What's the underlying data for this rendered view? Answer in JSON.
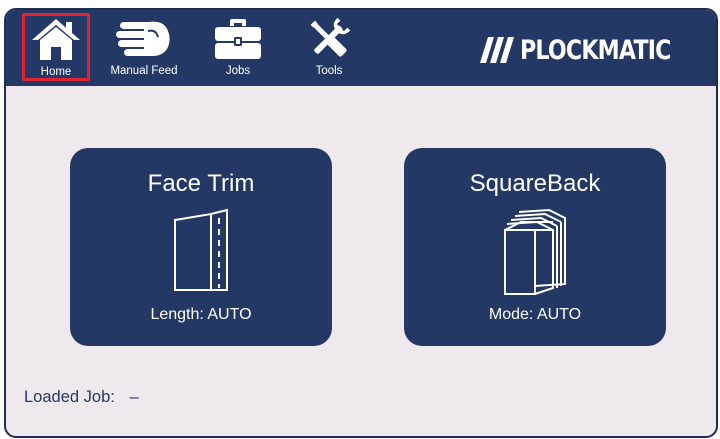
{
  "nav": {
    "home": {
      "label": "Home",
      "icon": "home-icon",
      "selected": true
    },
    "manual_feed": {
      "label": "Manual Feed",
      "icon": "hand-icon"
    },
    "jobs": {
      "label": "Jobs",
      "icon": "briefcase-icon"
    },
    "tools": {
      "label": "Tools",
      "icon": "tools-icon"
    }
  },
  "brand": {
    "name": "PLOCKMATIC"
  },
  "cards": {
    "face_trim": {
      "title": "Face Trim",
      "status": "Length: AUTO",
      "icon": "folded-sheet-icon"
    },
    "squareback": {
      "title": "SquareBack",
      "status": "Mode: AUTO",
      "icon": "book-stack-icon"
    }
  },
  "loaded_job": {
    "label": "Loaded Job:",
    "value": "–"
  },
  "colors": {
    "navy": "#233865",
    "background": "#efe9ed",
    "highlight": "#e0212f",
    "text_on_dark": "#ffffff"
  }
}
